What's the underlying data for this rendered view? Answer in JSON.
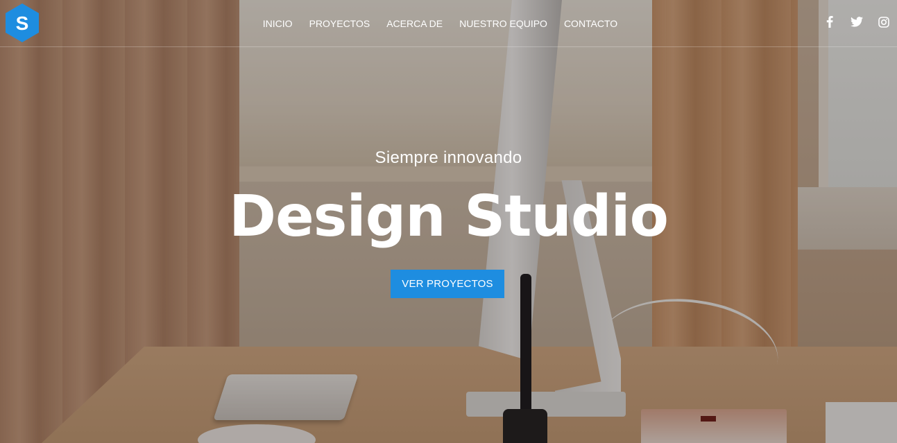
{
  "brand": {
    "logo_letter": "S",
    "accent": "#1e8de0"
  },
  "nav": {
    "items": [
      {
        "label": "INICIO"
      },
      {
        "label": "PROYECTOS"
      },
      {
        "label": "ACERCA DE"
      },
      {
        "label": "NUESTRO EQUIPO"
      },
      {
        "label": "CONTACTO"
      }
    ]
  },
  "social": [
    {
      "name": "facebook-icon"
    },
    {
      "name": "twitter-icon"
    },
    {
      "name": "instagram-icon"
    }
  ],
  "hero": {
    "tagline": "Siempre innovando",
    "title": "Design Studio",
    "cta_label": "VER PROYECTOS"
  },
  "colors": {
    "text": "#ffffff",
    "button": "#1e8de0"
  }
}
